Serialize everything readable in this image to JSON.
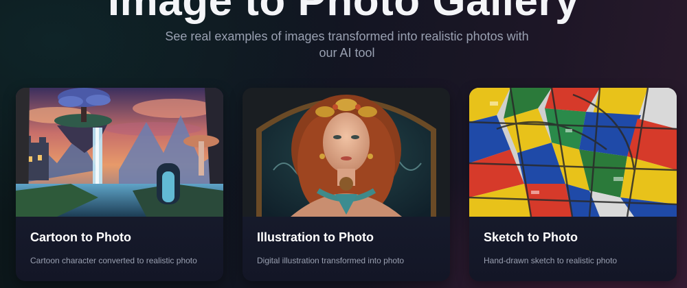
{
  "header": {
    "title": "Image to Photo Gallery",
    "subtitle": "See real examples of images transformed into realistic photos with our AI tool"
  },
  "gallery": {
    "cards": [
      {
        "title": "Cartoon to Photo",
        "description": "Cartoon character converted to realistic photo",
        "image": "fantasy-landscape-waterfall-image"
      },
      {
        "title": "Illustration to Photo",
        "description": "Digital illustration transformed into photo",
        "image": "portrait-woman-illustration-image"
      },
      {
        "title": "Sketch to Photo",
        "description": "Hand-drawn sketch to realistic photo",
        "image": "abstract-colorful-painting-image"
      }
    ]
  },
  "colors": {
    "card_bg": "#141726",
    "title_text": "#f4f5f8",
    "muted_text": "#9aa1b2"
  }
}
